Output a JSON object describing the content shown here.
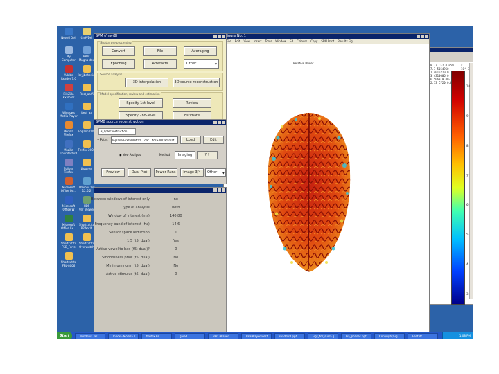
{
  "desktop": {
    "icons": [
      {
        "label": "Novell Deli",
        "color": "#3a78c8"
      },
      {
        "label": "Cn#/Del",
        "color": "#e8d070"
      },
      {
        "label": "My Computer",
        "color": "#9ab8e0"
      },
      {
        "label": "BRTC Magna-dec",
        "color": "#70a0d8"
      },
      {
        "label": "Adobe Reader 7.0",
        "color": "#c83030"
      },
      {
        "label": "for_jbehavior",
        "color": "#f0c050"
      },
      {
        "label": "FileZilla Explorer",
        "color": "#d04040"
      },
      {
        "label": "Rest_aa-fi",
        "color": "#f0c050"
      },
      {
        "label": "Windows Media Player",
        "color": "#3070c0"
      },
      {
        "label": "Rest_aa",
        "color": "#f0c050"
      },
      {
        "label": "Mozilla Firefox",
        "color": "#e88a30"
      },
      {
        "label": "Fogan/2009",
        "color": "#f0c050"
      },
      {
        "label": "Mozilla Thunderbird",
        "color": "#4070c0"
      },
      {
        "label": "Firefox 2005",
        "color": "#f0c050"
      },
      {
        "label": "Eclipse Firefox",
        "color": "#8080c0"
      },
      {
        "label": "Liquerer",
        "color": "#f0c050"
      },
      {
        "label": "Microsoft Office Ou...",
        "color": "#d06030"
      },
      {
        "label": "Theibus Vol 12.6.2",
        "color": "#60a0d0"
      },
      {
        "label": "Microsoft Office W",
        "color": "#3060c0"
      },
      {
        "label": "HDF Ver_Viewer",
        "color": "#70a070"
      },
      {
        "label": "Microsoft Office Ex...",
        "color": "#308040"
      },
      {
        "label": "Shortcut to PRWorld",
        "color": "#f0c050"
      },
      {
        "label": "Shortcut to FSB_Ferre",
        "color": "#f0c050"
      },
      {
        "label": "Shortcut to Overwatch",
        "color": "#f0c050"
      },
      {
        "label": "Shortcut to FSL-8006",
        "color": "#f0c050"
      }
    ]
  },
  "spm_main": {
    "title": "SPM (/mw/8)",
    "section1": "Spatial pre-processing",
    "btn_convert": "Convert",
    "btn_file": "File",
    "btn_averaging": "Averaging",
    "btn_epoching": "Epoching",
    "btn_artefacts": "Artefacts",
    "sel_other": "Other...",
    "section2": "Source analysis",
    "btn_3d_interp": "3D interpolation",
    "btn_3d_source": "3D source reconstruction",
    "section3": "Model specification, review and estimation",
    "btn_specify_1st": "Specify 1st-level",
    "btn_review": "Review",
    "btn_specify_2nd": "Specify 2nd-level",
    "btn_estimate": "Estimate"
  },
  "recon": {
    "title": "SPM8 source reconstruction",
    "label_recon": "3_1/Reconstruction",
    "label_field": "+ Paths",
    "input_value": "Inplane Firefo0Diffaz ...dat ...for+00Datamat",
    "btn_load": "Load",
    "btn_edit": "Edit",
    "radio_new": "New Analysis",
    "label_method": "Method",
    "btn_imaging": "Imaging",
    "btn_dots": "? ?",
    "btn_preview": "Preview",
    "btn_dual": "Dual Plot",
    "btn_power": "Power Runs",
    "btn_image": "Image 3/4",
    "sel_other": "Other"
  },
  "params": {
    "title": "",
    "rows": [
      {
        "label": "Between windows of interest only",
        "value": "no"
      },
      {
        "label": "Type of analysis",
        "value": "both"
      },
      {
        "label": "Window of interest (ms)",
        "value": "140  80"
      },
      {
        "label": "Frequency band of interest (Hz)",
        "value": "14  6"
      },
      {
        "label": "Sensor space reduction",
        "value": "1"
      },
      {
        "label": "1.5 (t5: dual)",
        "value": "Yes"
      },
      {
        "label": "Active vowel to bad (t5: dual)?",
        "value": "0"
      },
      {
        "label": "Smoothness prior (t5: dual)",
        "value": "No"
      },
      {
        "label": "Minimum norm (t5: dual)",
        "value": "No"
      },
      {
        "label": "Active stimulus (t5: dual)",
        "value": "0"
      }
    ]
  },
  "figure": {
    "title": "Figure No. 1",
    "menu": [
      "File",
      "Edit",
      "View",
      "Insert",
      "Tools",
      "Window",
      "Ed",
      "Colours",
      "Copy",
      "SPM Print",
      "Results Fig"
    ],
    "plot_title": "Relative Power",
    "colorbar_top": "x 10^-3",
    "colorbar_ticks": [
      "10",
      "9",
      "8",
      "7",
      "6",
      "5",
      "4",
      "3"
    ]
  },
  "matlab_window": {
    "lines": [
      "0.77 CF2 0.059",
      "7.7 5054960",
      "1 4016220 0",
      "3 4310006 0",
      "6 5060 0.003",
      "2.73 CF20 0.052"
    ]
  },
  "taskbar": {
    "start": "Start",
    "items": [
      "Windows Tas...",
      "Inbox - Mozilla T...",
      "firefox Re...",
      "gaied",
      "BBC iPlayer...",
      "RealPlayer Best...",
      "readhtrd.ppt",
      "Figs_for_surra.g...",
      "Fia_phases.ppt",
      "Copyright/Fig...",
      "Feathft"
    ],
    "clock": "1:08 PM"
  },
  "colors": {
    "desktop": "#2c62a8",
    "title_bar": "#0a246a",
    "spm_panel": "#f3efc8",
    "taskbar": "#2457c8"
  }
}
